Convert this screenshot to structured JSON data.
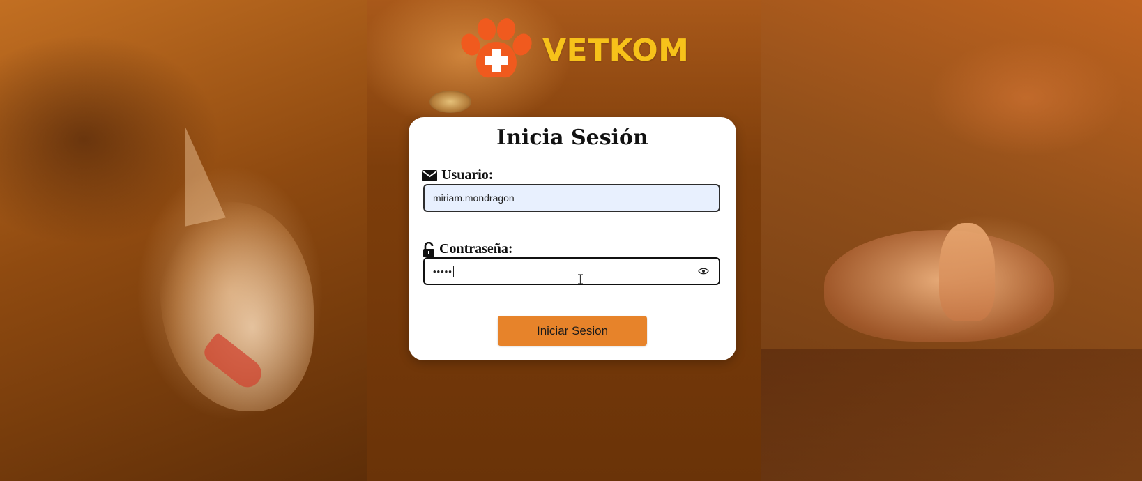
{
  "brand": {
    "name": "VETKOM",
    "logo_icon": "paw-cross-icon"
  },
  "login": {
    "title": "Inicia Sesión",
    "username_label": "Usuario:",
    "username_value": "miriam.mondragon",
    "password_label": "Contraseña:",
    "password_value": "•••••",
    "submit_label": "Iniciar Sesion"
  },
  "icons": {
    "user_icon": "envelope-icon",
    "password_icon": "unlock-icon",
    "toggle_icon": "eye-icon"
  },
  "colors": {
    "brand_text": "#f7c21a",
    "logo_paw": "#f05a1e",
    "button": "#e7832a",
    "username_bg": "#e8f0fe"
  }
}
